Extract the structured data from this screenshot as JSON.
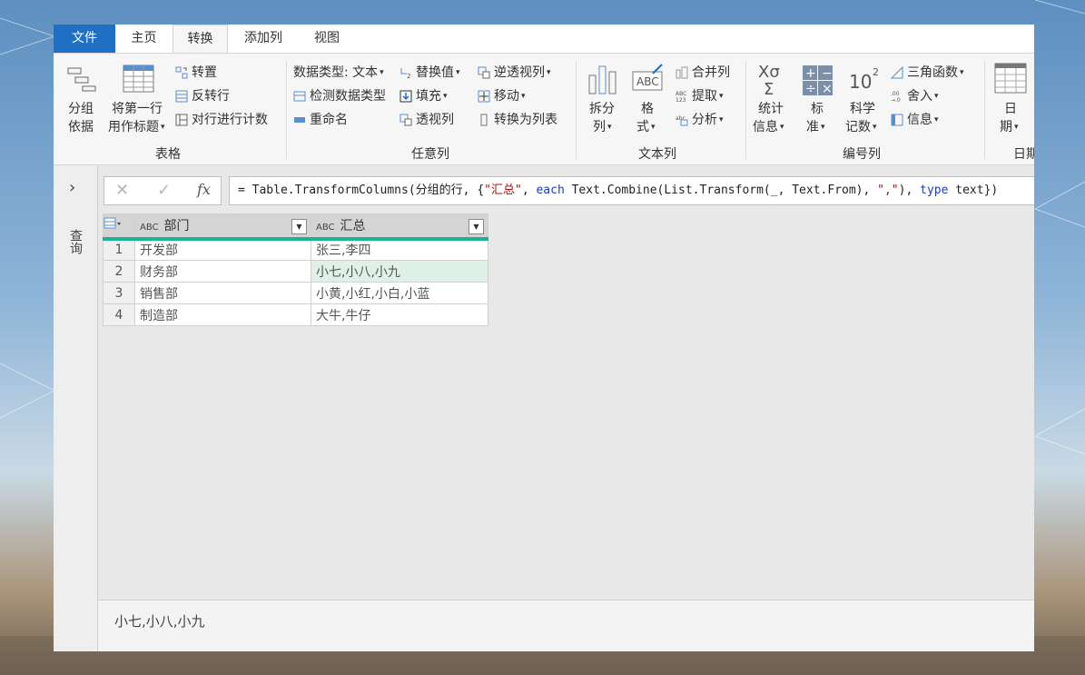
{
  "tabs": [
    "文件",
    "主页",
    "转换",
    "添加列",
    "视图"
  ],
  "ribbon": {
    "table_group": {
      "label": "表格",
      "group_by": [
        "分组",
        "依据"
      ],
      "first_row": [
        "将第一行",
        "用作标题"
      ],
      "transpose": "转置",
      "reverse_rows": "反转行",
      "count_rows": "对行进行计数"
    },
    "anycol_group": {
      "label": "任意列",
      "data_type": "数据类型: 文本",
      "detect_type": "检测数据类型",
      "rename": "重命名",
      "replace_values": "替换值",
      "fill": "填充",
      "pivot": "透视列",
      "unpivot": "逆透视列",
      "move": "移动",
      "to_list": "转换为列表"
    },
    "textcol_group": {
      "label": "文本列",
      "split": [
        "拆分",
        "列"
      ],
      "format": [
        "格",
        "式"
      ],
      "merge": "合并列",
      "extract": "提取",
      "parse": "分析"
    },
    "numcol_group": {
      "label": "编号列",
      "stats": [
        "统计",
        "信息"
      ],
      "standard": [
        "标",
        "准"
      ],
      "scientific": [
        "科学",
        "记数"
      ],
      "trig": "三角函数",
      "rounding": "舍入",
      "info": "信息"
    },
    "date_group": {
      "label": "日期",
      "date": [
        "日",
        "期"
      ]
    }
  },
  "left_panel": {
    "label": "查询"
  },
  "formula_bar": {
    "fx": "fx",
    "formula_parts": [
      "= Table.TransformColumns(分组的行, {",
      "\"汇总\"",
      ", ",
      "each",
      " Text.Combine(List.Transform(_, Text.From), ",
      "\",\"",
      "), ",
      "type",
      " text})"
    ]
  },
  "table": {
    "type_icon": "ABC",
    "columns": [
      "部门",
      "汇总"
    ],
    "rows": [
      {
        "n": "1",
        "dept": "开发部",
        "summary": "张三,李四"
      },
      {
        "n": "2",
        "dept": "财务部",
        "summary": "小七,小八,小九"
      },
      {
        "n": "3",
        "dept": "销售部",
        "summary": "小黄,小红,小白,小蓝"
      },
      {
        "n": "4",
        "dept": "制造部",
        "summary": "大牛,牛仔"
      }
    ]
  },
  "preview": {
    "value": "小七,小八,小九"
  },
  "colors": {
    "accent": "#1f6fc5",
    "header_underline": "#1ab394",
    "selected_cell": "#dff0e6"
  }
}
